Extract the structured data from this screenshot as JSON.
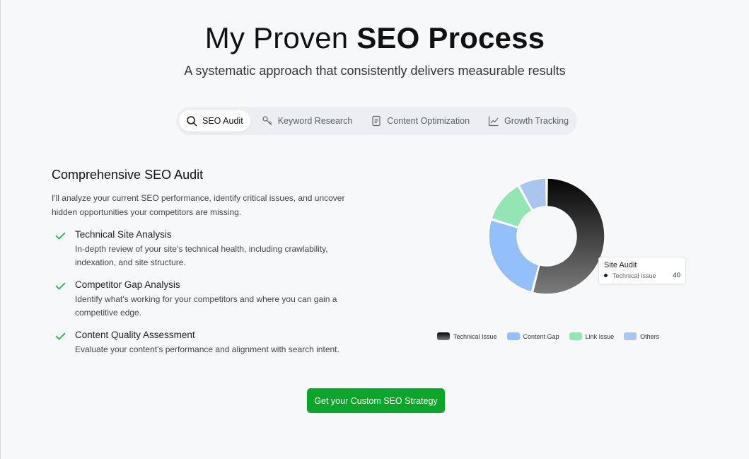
{
  "header": {
    "title_light": "My Proven ",
    "title_bold": "SEO Process",
    "subtitle": "A systematic approach that consistently delivers measurable results"
  },
  "tabs": [
    {
      "label": "SEO Audit",
      "icon": "search-icon",
      "active": true
    },
    {
      "label": "Keyword Research",
      "icon": "key-icon",
      "active": false
    },
    {
      "label": "Content Optimization",
      "icon": "document-icon",
      "active": false
    },
    {
      "label": "Growth Tracking",
      "icon": "line-chart-icon",
      "active": false
    }
  ],
  "panel": {
    "heading": "Comprehensive SEO Audit",
    "intro": "I'll analyze your current SEO performance, identify critical issues, and uncover hidden opportunities your competitors are missing.",
    "features": [
      {
        "title": "Technical Site Analysis",
        "desc": "In-depth review of your site's technical health, including crawlability, indexation, and site structure."
      },
      {
        "title": "Competitor Gap Analysis",
        "desc": "Identify what's working for your competitors and where you can gain a competitive edge."
      },
      {
        "title": "Content Quality Assessment",
        "desc": "Evaluate your content's performance and alignment with search intent."
      }
    ]
  },
  "cta": {
    "label": "Get your Custom SEO Strategy",
    "color": "#0aa52a"
  },
  "tooltip": {
    "title": "Site Audit",
    "label": "Technical Issue",
    "value": "40"
  },
  "chart_data": {
    "type": "pie",
    "categories": [
      "Technical Issue",
      "Content Gap",
      "Link Issue",
      "Others"
    ],
    "values": [
      40,
      19,
      9,
      6
    ],
    "colors": [
      "#111111",
      "#93c0fb",
      "#93e6b4",
      "#abc6ee"
    ],
    "legend": "bottom"
  }
}
